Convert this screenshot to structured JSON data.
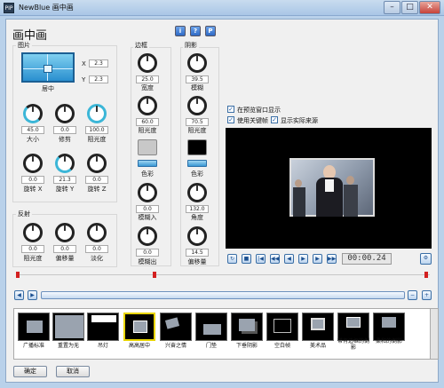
{
  "window": {
    "app_icon_text": "PIP",
    "title": "NewBlue 画中画"
  },
  "heading": "画中画",
  "help_buttons": [
    "i",
    "?",
    "P"
  ],
  "picture": {
    "title": "图片",
    "position_label": "居中",
    "x_label": "X",
    "x_value": "2.3",
    "y_label": "Y",
    "y_value": "2.3",
    "knobs": [
      {
        "value": "45.0",
        "label": "大小"
      },
      {
        "value": "0.0",
        "label": "修剪"
      },
      {
        "value": "100.0",
        "label": "阻光度"
      },
      {
        "value": "0.0",
        "label": "旋转 X"
      },
      {
        "value": "21.3",
        "label": "旋转 Y"
      },
      {
        "value": "0.0",
        "label": "旋转 Z"
      }
    ]
  },
  "reflection": {
    "title": "反射",
    "knobs": [
      {
        "value": "0.0",
        "label": "阻光度"
      },
      {
        "value": "0.0",
        "label": "偏移量"
      },
      {
        "value": "0.0",
        "label": "淡化"
      }
    ]
  },
  "border": {
    "title": "边框",
    "knobs": [
      {
        "value": "25.0",
        "label": "宽度"
      },
      {
        "value": "60.0",
        "label": "阻光度"
      },
      {
        "value": "0.0",
        "label": "模糊入"
      },
      {
        "value": "0.0",
        "label": "模糊出"
      }
    ],
    "color_label": "色彩",
    "color": "#c8c8c8"
  },
  "shadow": {
    "title": "阴影",
    "knobs": [
      {
        "value": "39.5",
        "label": "模糊"
      },
      {
        "value": "70.5",
        "label": "阻光度"
      },
      {
        "value": "132.0",
        "label": "角度"
      },
      {
        "value": "14.5",
        "label": "偏移量"
      }
    ],
    "color_label": "色彩",
    "color": "#000000"
  },
  "options": [
    {
      "label": "在预览窗口显示",
      "checked": true
    },
    {
      "label": "使用关键帧",
      "checked": true
    },
    {
      "label": "显示实际来源",
      "checked": true
    }
  ],
  "transport": {
    "buttons": [
      "↻",
      "■",
      "|◀",
      "◀◀",
      "◀",
      "▶",
      "▶",
      "▶▶",
      "▶|"
    ],
    "timecode": "00:00.24"
  },
  "thumbnails": [
    {
      "label": "广播标准"
    },
    {
      "label": "重置为无"
    },
    {
      "label": "吊灯"
    },
    {
      "label": "高高居中"
    },
    {
      "label": "兴奋之情"
    },
    {
      "label": "门垫"
    },
    {
      "label": "下垂阴影"
    },
    {
      "label": "空白帧"
    },
    {
      "label": "美术品"
    },
    {
      "label": "带有边框的倒影"
    },
    {
      "label": "柔和的倒影"
    }
  ],
  "footer": {
    "ok": "确定",
    "cancel": "取消"
  }
}
